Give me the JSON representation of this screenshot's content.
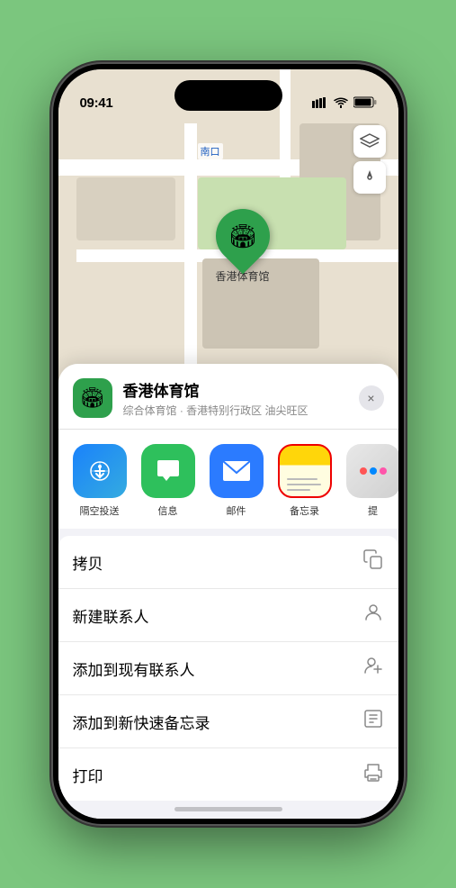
{
  "status_bar": {
    "time": "09:41",
    "signal": "▌▌▌",
    "wifi": "WiFi",
    "battery": "Battery"
  },
  "map": {
    "label_nankou": "南口"
  },
  "map_controls": {
    "layers_icon": "🗺",
    "location_icon": "➤"
  },
  "venue": {
    "name": "香港体育馆",
    "icon": "🏟",
    "subtitle": "综合体育馆 · 香港特别行政区 油尖旺区",
    "pin_label": "香港体育馆"
  },
  "share_items": [
    {
      "id": "airdrop",
      "label": "隔空投送",
      "type": "airdrop"
    },
    {
      "id": "messages",
      "label": "信息",
      "type": "messages"
    },
    {
      "id": "mail",
      "label": "邮件",
      "type": "mail"
    },
    {
      "id": "notes",
      "label": "备忘录",
      "type": "notes",
      "selected": true
    },
    {
      "id": "more",
      "label": "提",
      "type": "more"
    }
  ],
  "actions": [
    {
      "id": "copy",
      "label": "拷贝",
      "icon": "copy"
    },
    {
      "id": "new-contact",
      "label": "新建联系人",
      "icon": "person"
    },
    {
      "id": "add-existing",
      "label": "添加到现有联系人",
      "icon": "person-add"
    },
    {
      "id": "add-notes",
      "label": "添加到新快速备忘录",
      "icon": "note"
    },
    {
      "id": "print",
      "label": "打印",
      "icon": "print"
    }
  ],
  "close_label": "×"
}
